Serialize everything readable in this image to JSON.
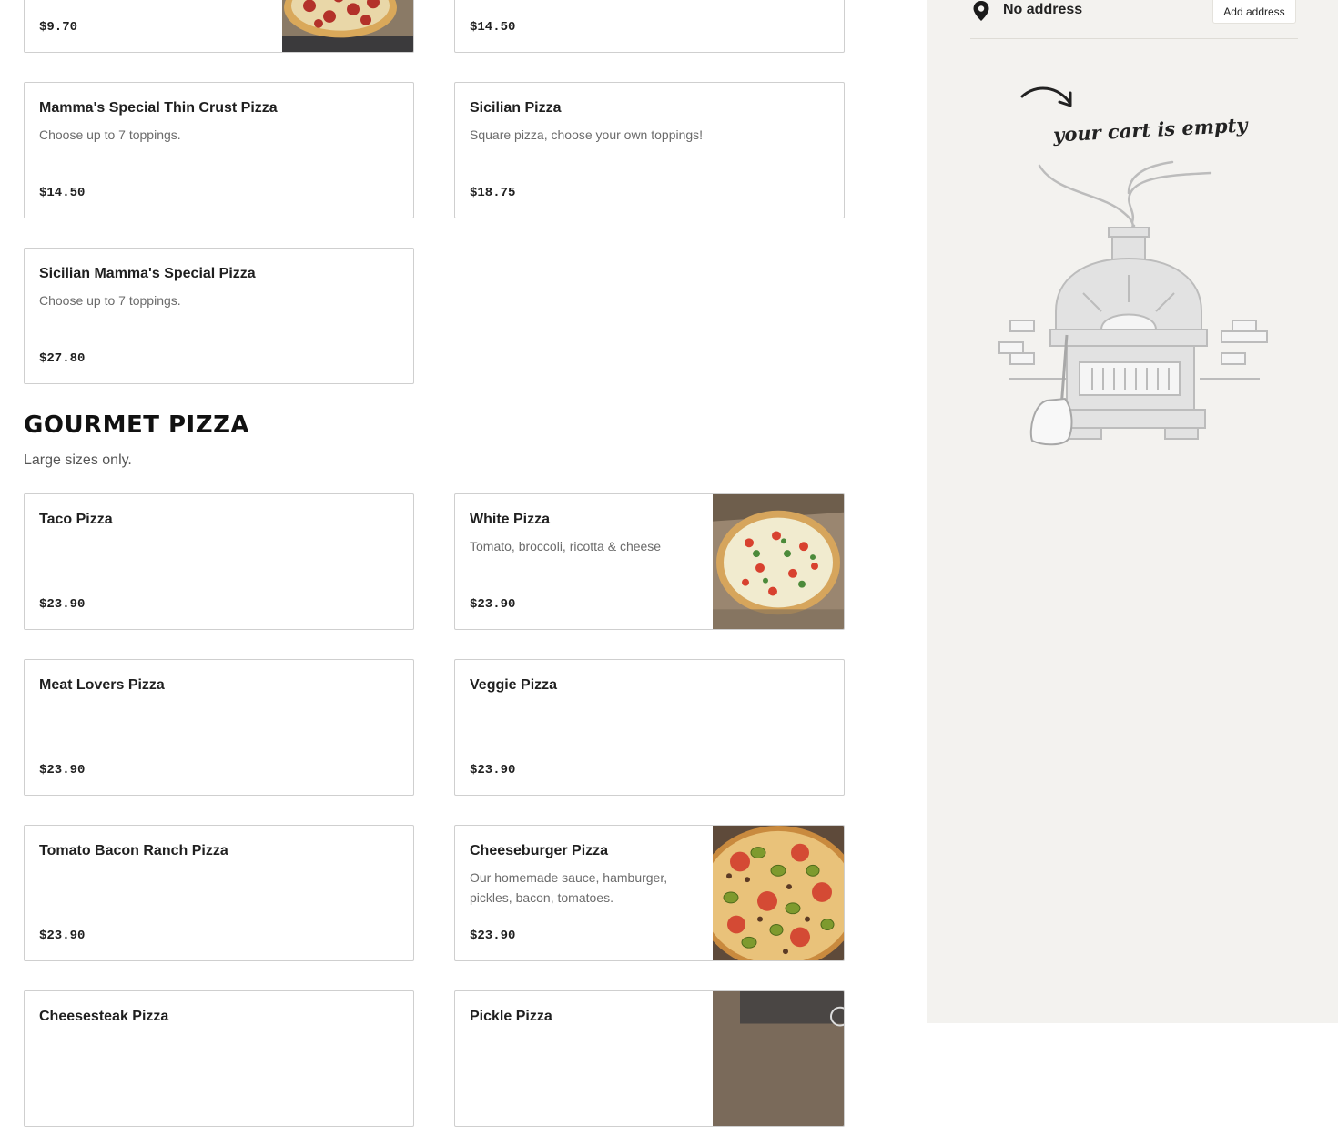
{
  "sections": {
    "gourmet": {
      "title": "GOURMET PIZZA",
      "subtitle": "Large sizes only."
    }
  },
  "items": [
    {
      "name": "",
      "desc": "",
      "price": "$9.70",
      "has_photo": true
    },
    {
      "name": "",
      "desc": "",
      "price": "$14.50",
      "has_photo": false
    },
    {
      "name": "Mamma's Special Thin Crust Pizza",
      "desc": "Choose up to 7 toppings.",
      "price": "$14.50",
      "has_photo": false
    },
    {
      "name": "Sicilian Pizza",
      "desc": "Square pizza, choose your own toppings!",
      "price": "$18.75",
      "has_photo": false
    },
    {
      "name": "Sicilian Mamma's Special Pizza",
      "desc": "Choose up to 7 toppings.",
      "price": "$27.80",
      "has_photo": false
    },
    {
      "name": "Taco Pizza",
      "desc": "",
      "price": "$23.90",
      "has_photo": false
    },
    {
      "name": "White Pizza",
      "desc": "Tomato, broccoli, ricotta & cheese",
      "price": "$23.90",
      "has_photo": true
    },
    {
      "name": "Meat Lovers Pizza",
      "desc": "",
      "price": "$23.90",
      "has_photo": false
    },
    {
      "name": "Veggie Pizza",
      "desc": "",
      "price": "$23.90",
      "has_photo": false
    },
    {
      "name": "Tomato Bacon Ranch Pizza",
      "desc": "",
      "price": "$23.90",
      "has_photo": false
    },
    {
      "name": "Cheeseburger Pizza",
      "desc": "Our homemade sauce, hamburger, pickles, bacon, tomatoes.",
      "price": "$23.90",
      "has_photo": true
    },
    {
      "name": "Cheesesteak Pizza",
      "desc": "",
      "price": "",
      "has_photo": false
    },
    {
      "name": "Pickle Pizza",
      "desc": "",
      "price": "",
      "has_photo": true
    }
  ],
  "cart": {
    "address_icon": "location-pin-icon",
    "address_text": "No address",
    "add_address_label": "Add address",
    "empty_text": "your cart is empty"
  }
}
